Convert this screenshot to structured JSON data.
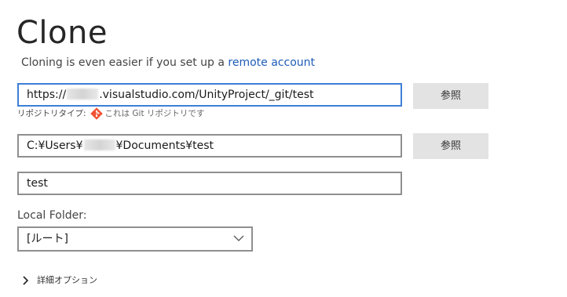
{
  "page": {
    "title": "Clone",
    "subtitle_prefix": "Cloning is even easier if you set up a ",
    "subtitle_link": "remote account"
  },
  "repo_url": {
    "prefix": "https://",
    "suffix": ".visualstudio.com/UnityProject/_git/test",
    "browse_label": "参照"
  },
  "repo_type": {
    "label": "リポジトリタイプ:",
    "value": "これは Git リポジトリです",
    "icon": "git-icon",
    "icon_color": "#f05133"
  },
  "local_path": {
    "prefix": "C:¥Users¥",
    "suffix": "¥Documents¥test",
    "browse_label": "参照"
  },
  "name_field": {
    "value": "test"
  },
  "local_folder": {
    "label": "Local Folder:",
    "selected": "[ルート]"
  },
  "advanced": {
    "label": "詳細オプション",
    "icon": "chevron-right-icon"
  },
  "colors": {
    "focus_border": "#3d7fd6",
    "link": "#1e5bb8",
    "button_bg": "#e3e3e3"
  }
}
